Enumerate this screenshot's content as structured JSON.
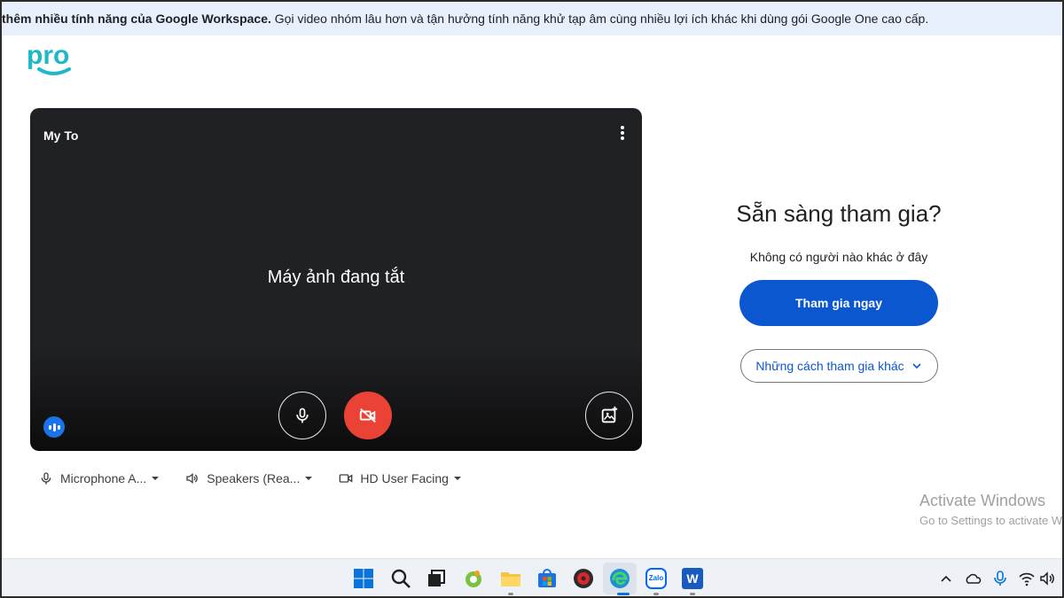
{
  "banner": {
    "bold_text": "thêm nhiều tính năng của Google Workspace.",
    "text": " Gọi video nhóm lâu hơn và tận hưởng tính năng khử tạp âm cùng nhiều lợi ích khác khi dùng gói Google One cao cấp."
  },
  "logo": {
    "text": "pro",
    "color": "#1fb8c8"
  },
  "preview": {
    "user_name": "My To",
    "camera_off_text": "Máy ảnh đang tắt",
    "mic_icon": "microphone-icon",
    "camera_icon": "camera-off-icon",
    "effects_icon": "visual-effects-icon",
    "more_icon": "more-vert-icon"
  },
  "devices": {
    "microphone": "Microphone A...",
    "speakers": "Speakers (Rea...",
    "camera": "HD User Facing"
  },
  "join": {
    "title": "Sẵn sàng tham gia?",
    "subtitle": "Không có người nào khác ở đây",
    "join_now": "Tham gia ngay",
    "other_ways": "Những cách tham gia khác"
  },
  "watermark": {
    "title": "Activate Windows",
    "subtitle": "Go to Settings to activate W"
  },
  "taskbar": {
    "apps": [
      "windows-start-icon",
      "search-icon",
      "task-view-icon",
      "coccoc-browser-icon",
      "file-explorer-icon",
      "microsoft-store-icon",
      "app-icon",
      "edge-icon",
      "zalo-icon",
      "word-icon"
    ],
    "zalo_label": "Zalo",
    "word_label": "W"
  },
  "colors": {
    "accent": "#0b57d0",
    "camera_off": "#ea4335",
    "banner_bg": "#e8f0fe"
  }
}
